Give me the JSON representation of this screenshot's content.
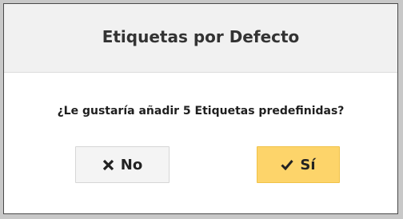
{
  "dialog": {
    "title": "Etiquetas por Defecto",
    "message": "¿Le gustaría añadir 5 Etiquetas predefinidas?",
    "buttons": {
      "no": {
        "label": "No",
        "icon": "close-icon"
      },
      "yes": {
        "label": "Sí",
        "icon": "checkmark-icon"
      }
    }
  },
  "colors": {
    "header_bg": "#f1f1f1",
    "yes_button_bg": "#fdd46a",
    "no_button_bg": "#f4f4f4"
  }
}
